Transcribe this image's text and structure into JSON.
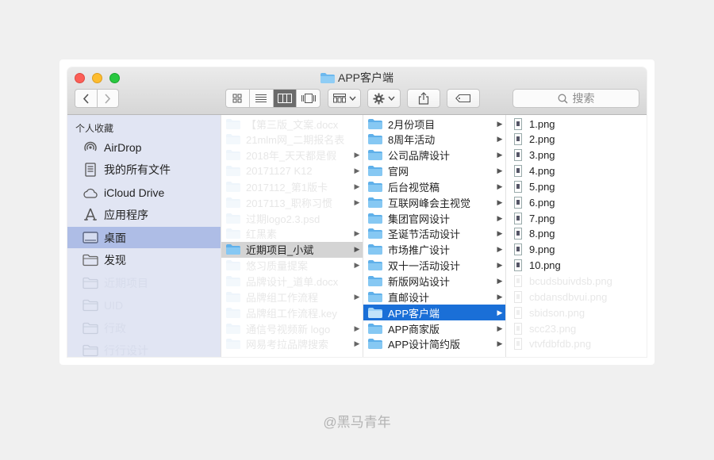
{
  "window": {
    "title": "APP客户端"
  },
  "search": {
    "placeholder": "搜索"
  },
  "sidebar": {
    "header": "个人收藏",
    "items": [
      {
        "label": "AirDrop",
        "icon": "airdrop-icon"
      },
      {
        "label": "我的所有文件",
        "icon": "all-files-icon"
      },
      {
        "label": "iCloud Drive",
        "icon": "icloud-icon"
      },
      {
        "label": "应用程序",
        "icon": "applications-icon"
      },
      {
        "label": "桌面",
        "icon": "desktop-icon",
        "selected": true
      },
      {
        "label": "发现",
        "icon": "folder-icon"
      },
      {
        "label": "近期项目",
        "icon": "folder-icon"
      },
      {
        "label": "UID",
        "icon": "folder-icon"
      },
      {
        "label": "行政",
        "icon": "folder-icon"
      },
      {
        "label": "行行设计",
        "icon": "folder-icon"
      }
    ]
  },
  "column1": [
    {
      "name": "【第三版_文案.docx",
      "faded": true
    },
    {
      "name": "21mlm网_二期报名表",
      "faded": true
    },
    {
      "name": "2018年_天天都是假",
      "faded": true,
      "arrow": true
    },
    {
      "name": "20171127 K12",
      "faded": true,
      "arrow": true
    },
    {
      "name": "2017112_第1版卡",
      "faded": true,
      "arrow": true
    },
    {
      "name": "2017113_职称习惯",
      "faded": true,
      "arrow": true
    },
    {
      "name": "过期logo2.3.psd",
      "faded": true
    },
    {
      "name": "红黑素",
      "faded": true,
      "arrow": true
    },
    {
      "name": "近期项目_小斌",
      "selected": true,
      "arrow": true
    },
    {
      "name": "悠习质量提案",
      "faded": true,
      "arrow": true
    },
    {
      "name": "品牌设计_道单.docx",
      "faded": true
    },
    {
      "name": "品牌组工作流程",
      "faded": true,
      "arrow": true
    },
    {
      "name": "品牌组工作流程.key",
      "faded": true
    },
    {
      "name": "通信号视频新 logo",
      "faded": true,
      "arrow": true
    },
    {
      "name": "网易考拉品牌搜索",
      "faded": true,
      "arrow": true
    }
  ],
  "column2": [
    {
      "name": "2月份项目"
    },
    {
      "name": "8周年活动"
    },
    {
      "name": "公司品牌设计"
    },
    {
      "name": "官网"
    },
    {
      "name": "后台视觉稿"
    },
    {
      "name": "互联网峰会主视觉"
    },
    {
      "name": "集团官网设计"
    },
    {
      "name": "圣诞节活动设计"
    },
    {
      "name": "市场推广设计"
    },
    {
      "name": "双十一活动设计"
    },
    {
      "name": "新版网站设计"
    },
    {
      "name": "直邮设计"
    },
    {
      "name": "APP客户端",
      "selected": true
    },
    {
      "name": "APP商家版"
    },
    {
      "name": "APP设计简约版"
    }
  ],
  "column3": [
    {
      "name": "1.png"
    },
    {
      "name": "2.png"
    },
    {
      "name": "3.png"
    },
    {
      "name": "4.png"
    },
    {
      "name": "5.png"
    },
    {
      "name": "6.png"
    },
    {
      "name": "7.png"
    },
    {
      "name": "8.png"
    },
    {
      "name": "9.png"
    },
    {
      "name": "10.png"
    },
    {
      "name": "bcudsbuivdsb.png",
      "faded": true
    },
    {
      "name": "cbdansdbvui.png",
      "faded": true
    },
    {
      "name": "sbidson.png",
      "faded": true
    },
    {
      "name": "scc23.png",
      "faded": true
    },
    {
      "name": "vtvfdbfdb.png",
      "faded": true
    }
  ],
  "credit": "@黑马青年",
  "colors": {
    "selection": "#1a6fd7",
    "sidebar": "#e1e5f3",
    "folder": "#6cb8ee"
  }
}
